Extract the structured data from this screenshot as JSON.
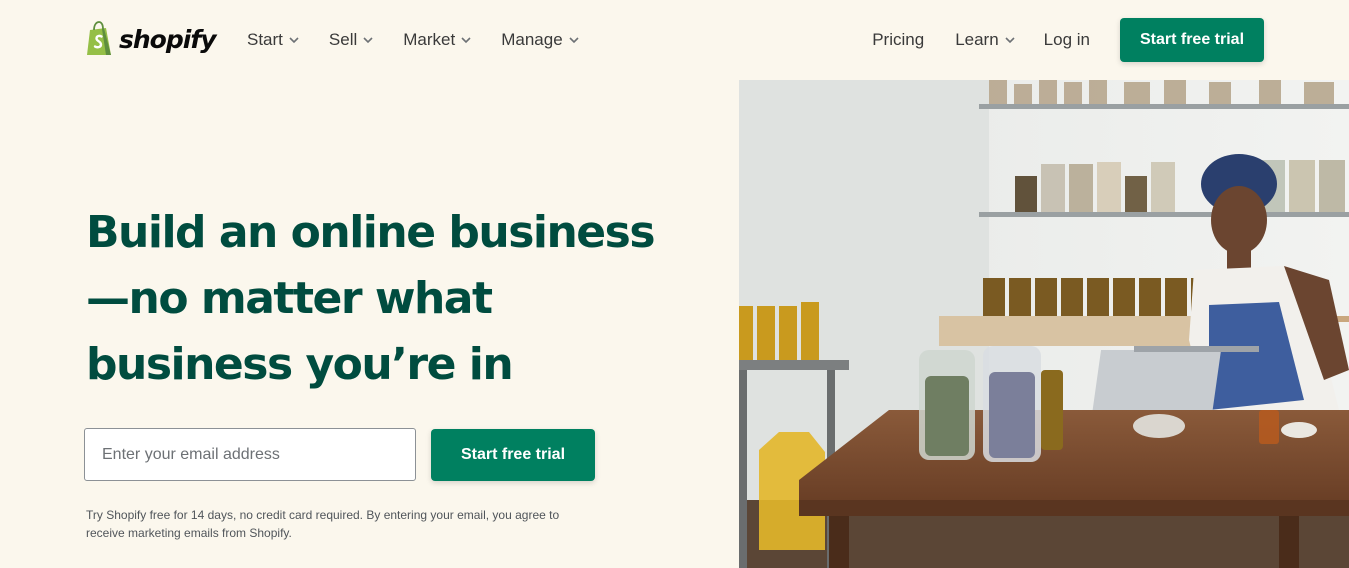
{
  "brand": {
    "name": "shopify"
  },
  "nav": {
    "left": [
      {
        "label": "Start"
      },
      {
        "label": "Sell"
      },
      {
        "label": "Market"
      },
      {
        "label": "Manage"
      }
    ],
    "pricing": "Pricing",
    "learn": "Learn",
    "login": "Log in",
    "cta": "Start free trial"
  },
  "hero": {
    "title_lines": [
      "Build an online business",
      "—no matter what",
      "business you’re in"
    ],
    "email_placeholder": "Enter your email address",
    "cta": "Start free trial",
    "disclaimer": "Try Shopify free for 14 days, no credit card required. By entering your email, you agree to receive marketing emails from Shopify."
  },
  "colors": {
    "background": "#fbf7ed",
    "accent": "#008060",
    "heading": "#004c3f",
    "logo_green": "#95bf47"
  },
  "icons": [
    "shopify-bag-icon",
    "chevron-down-icon"
  ]
}
